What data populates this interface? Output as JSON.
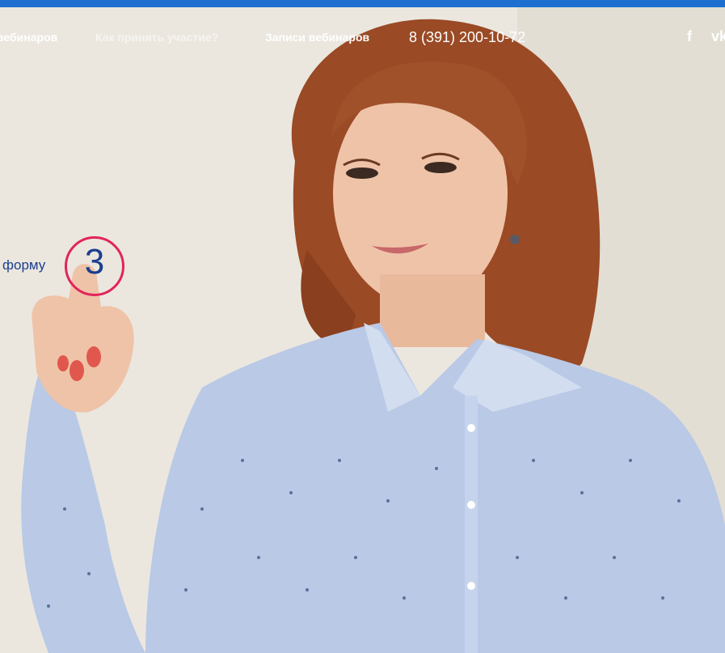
{
  "nav": {
    "links": [
      {
        "label": "вебинаров"
      },
      {
        "label": "Как принять участие?"
      },
      {
        "label": "Записи вебинаров"
      }
    ],
    "phone": "8 (391) 200-10-72",
    "social_icons": [
      "facebook-icon",
      "vk-icon"
    ]
  },
  "hero": {
    "step_text": "форму",
    "step_number": "3"
  },
  "colors": {
    "top_bar": "#1f6fd1",
    "step_circle": "#e2245a",
    "step_text": "#1b3f8f",
    "shirt": "#b9c9e6",
    "hair": "#9a4a25"
  }
}
